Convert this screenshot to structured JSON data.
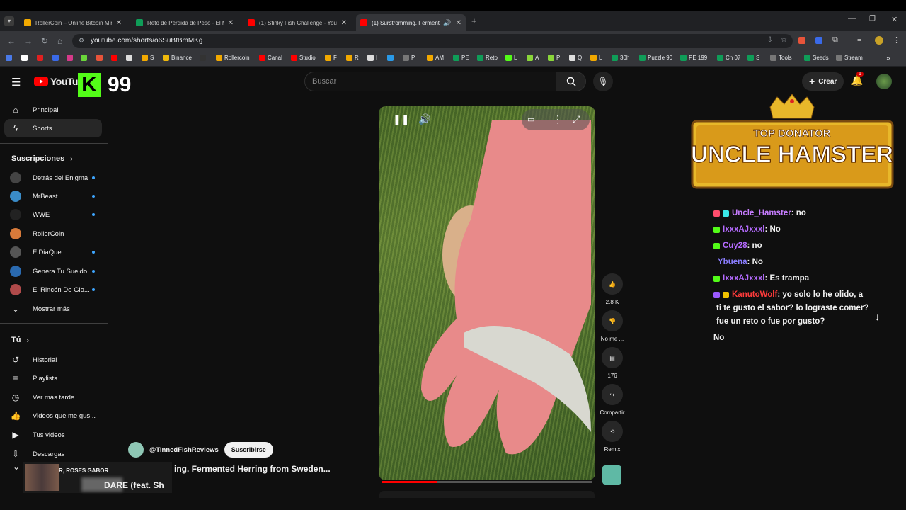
{
  "browser": {
    "tabs": [
      {
        "title": "RollerCoin – Online Bitcoin Min",
        "color": "#f2a900"
      },
      {
        "title": "Reto de Perdida de Peso - El M",
        "color": "#0f9d58"
      },
      {
        "title": "(1) Stinky Fish Challenge - YouT",
        "color": "#ff0000"
      },
      {
        "title": "(1) Surströmming. Ferment",
        "color": "#ff0000"
      }
    ],
    "url": "youtube.com/shorts/o6SuBtBmMKg",
    "bookmarks": [
      "S",
      "Binance",
      "Rollercoin",
      "Canal",
      "Studio",
      "F",
      "R",
      "I",
      "P",
      "AM",
      "PE",
      "Reto",
      "L",
      "A",
      "P",
      "Q",
      "L",
      "30h",
      "Puzzle 90",
      "PE 199",
      "Ch 07",
      "S",
      "Tools",
      "Seeds",
      "Stream"
    ]
  },
  "header": {
    "logo_text": "YouTube",
    "kick_letter": "K",
    "kick_count": "99",
    "search_placeholder": "Buscar",
    "create_label": "Crear",
    "notif_count": "1"
  },
  "sidebar": {
    "main": [
      {
        "label": "Principal",
        "icon": "home-icon"
      },
      {
        "label": "Shorts",
        "icon": "shorts-icon"
      }
    ],
    "subs_title": "Suscripciones",
    "subs": [
      {
        "label": "Detrás del Enigma",
        "color": "#444"
      },
      {
        "label": "MrBeast",
        "color": "#3a8cc8"
      },
      {
        "label": "WWE",
        "color": "#222"
      },
      {
        "label": "RollerCoin",
        "color": "#d77a3a"
      },
      {
        "label": "ElDiaQue",
        "color": "#555"
      },
      {
        "label": "Genera Tu Sueldo",
        "color": "#2a6ab0"
      },
      {
        "label": "El Rincón De Gio...",
        "color": "#b04a4a"
      }
    ],
    "show_more": "Mostrar más",
    "you_title": "Tú",
    "you": [
      {
        "label": "Historial",
        "icon": "history-icon"
      },
      {
        "label": "Playlists",
        "icon": "playlist-icon"
      },
      {
        "label": "Ver más tarde",
        "icon": "clock-icon"
      },
      {
        "label": "Videos que me gus...",
        "icon": "like-icon"
      },
      {
        "label": "Tus videos",
        "icon": "video-icon"
      },
      {
        "label": "Descargas",
        "icon": "download-icon"
      }
    ]
  },
  "short": {
    "channel": "@TinnedFishReviews",
    "subscribe": "Suscribirse",
    "title": "ing. Fermented Herring from Sweden...",
    "progress": 0.26,
    "likes": "2.8 K",
    "dislike_label": "No me ...",
    "comments": "176",
    "share_label": "Compartir",
    "remix_label": "Remix"
  },
  "overlay": {
    "music_line1": "R, ROSES GABOR",
    "music_line2": "DARE (feat. Sh",
    "donator_title": "TOP DONATOR",
    "donator_name": "UNCLE HAMSTER"
  },
  "chat": [
    {
      "user": "Uncle_Hamster",
      "msg": ": no",
      "color": "#c77dff",
      "badge": "#ff4d6d"
    },
    {
      "user": "IxxxAJxxxl",
      "msg": ": No",
      "color": "#b56bff",
      "badge": "#53fc18"
    },
    {
      "user": "Cuy28",
      "msg": ": no",
      "color": "#b56bff",
      "badge": "#53fc18"
    },
    {
      "user": "Ybuena",
      "msg": ": No",
      "color": "#8a7dff",
      "badge": ""
    },
    {
      "user": "IxxxAJxxxl",
      "msg": ": Es trampa",
      "color": "#b56bff",
      "badge": "#53fc18"
    },
    {
      "user": "KanutoWolf",
      "msg": ": yo solo lo he olido, a",
      "color": "#ff3b3b",
      "badge": "#9b59ff"
    },
    {
      "user": "",
      "msg": "ti te gusto el sabor? lo lograste comer?",
      "color": "",
      "badge": ""
    },
    {
      "user": "",
      "msg": "fue un reto o fue por gusto?",
      "color": "",
      "badge": ""
    },
    {
      "user": "",
      "msg": "No",
      "color": "",
      "badge": ""
    }
  ]
}
